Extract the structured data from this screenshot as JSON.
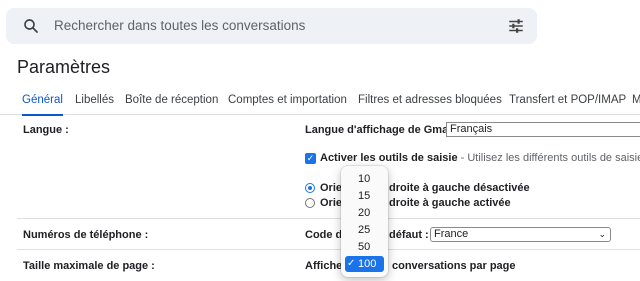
{
  "search": {
    "placeholder": "Rechercher dans toutes les conversations"
  },
  "icons": {
    "search": "search-icon",
    "filter": "tune-icon",
    "check": "check-icon",
    "chevron": "chevron-down-icon"
  },
  "page_title": "Paramètres",
  "tabs": [
    {
      "label": "Général",
      "active": true
    },
    {
      "label": "Libellés"
    },
    {
      "label": "Boîte de réception"
    },
    {
      "label": "Comptes et importation"
    },
    {
      "label": "Filtres et adresses bloquées"
    },
    {
      "label": "Transfert et POP/IMAP"
    },
    {
      "label": "M"
    }
  ],
  "settings": {
    "language": {
      "label": "Langue :",
      "display_label": "Langue d'affichage de Gmail :",
      "display_value": "Français",
      "input_tools_label": "Activer les outils de saisie",
      "input_tools_desc": " - Utilisez les différents outils de saisie de",
      "rtl_off_a": "Orie",
      "rtl_off_b": "droite à gauche désactivée",
      "rtl_on_a": "Orie",
      "rtl_on_b": "droite à gauche activée"
    },
    "phone": {
      "label": "Numéros de téléphone :",
      "code_a": "Code de",
      "code_b": "défaut :",
      "country_value": "France"
    },
    "page_size": {
      "label": "Taille maximale de page :",
      "show_a": "Affiche",
      "show_b": "conversations par page",
      "options": [
        "10",
        "15",
        "20",
        "25",
        "50",
        "100"
      ],
      "selected": "100"
    }
  },
  "colors": {
    "accent": "#1a73e8",
    "tab_active": "#0b57d0",
    "search_bg": "#eef2f7"
  }
}
